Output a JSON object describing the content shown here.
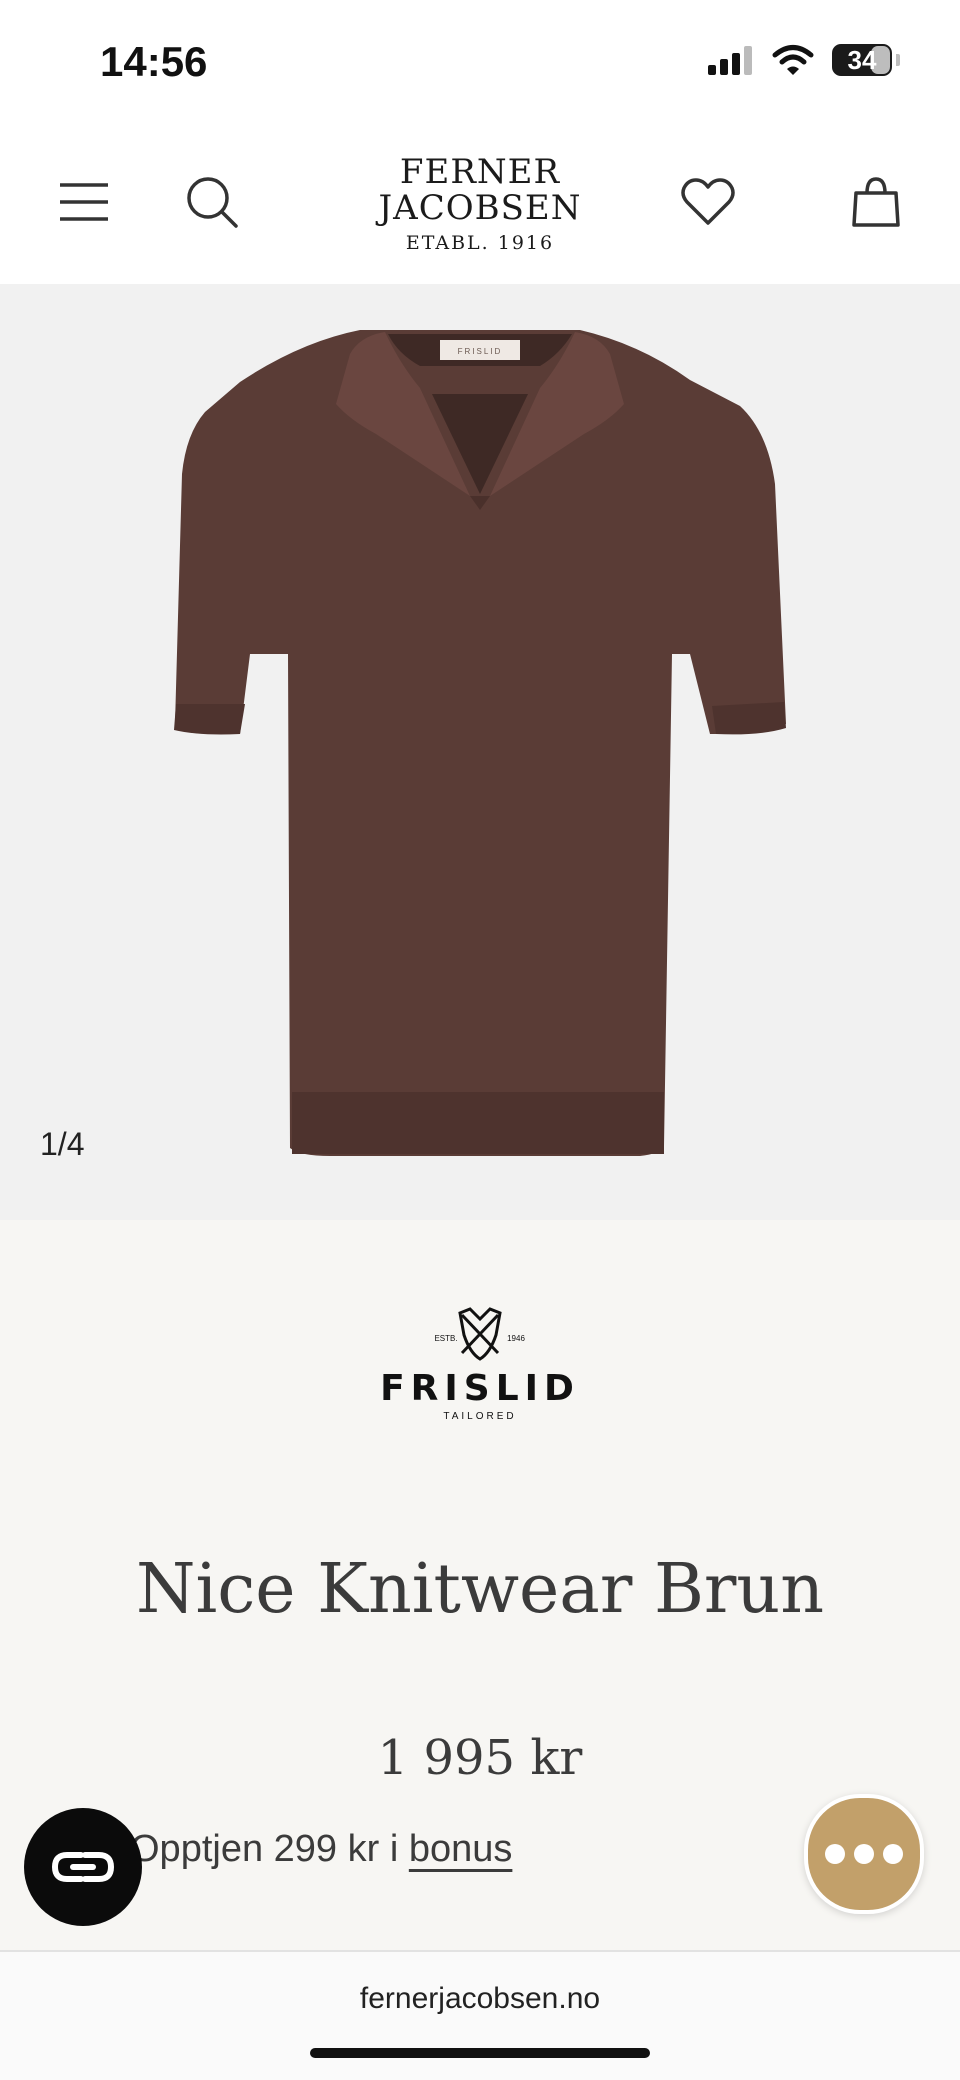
{
  "status_bar": {
    "time": "14:56",
    "battery_level": "34",
    "battery_fraction": 0.34
  },
  "header": {
    "logo_lines": [
      "FERNER",
      "JACOBSEN"
    ],
    "logo_established": "ETABL. 1916",
    "icons": [
      "menu-icon",
      "search-icon",
      "heart-icon",
      "bag-icon"
    ]
  },
  "gallery": {
    "counter": "1/4",
    "image": "brown-knit-polo",
    "label_text": "FRISLID"
  },
  "product": {
    "brand_name": "FRISLID",
    "brand_sub": "TAILORED",
    "brand_est_left": "ESTB.",
    "brand_est_right": "1946",
    "title": "Nice Knitwear Brun",
    "price": "1 995 kr",
    "bonus_prefix": "Opptjen 299 kr i ",
    "bonus_link": "bonus"
  },
  "browser": {
    "url": "fernerjacobsen.no"
  },
  "colors": {
    "accent": "#c2a06a",
    "shirt": "#5a3c36",
    "text": "#3b3b3b"
  }
}
